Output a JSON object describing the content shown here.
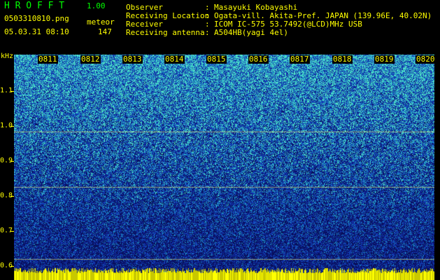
{
  "app": {
    "title": "H R O F F T",
    "version": "1.00"
  },
  "file": {
    "name": "0503310810.png",
    "datetime": "05.03.31 08:10",
    "mode_label": "meteor",
    "count": "147"
  },
  "header": {
    "observer_label": "Observer",
    "observer_value": "Masayuki Kobayashi",
    "location_label": "Receiving Location",
    "location_value": "Ogata-vill. Akita-Pref. JAPAN (139.96E, 40.02N)",
    "receiver_label": "Receiver",
    "receiver_value": "ICOM IC-575 53.7492(@LCD)MHz USB",
    "antenna_label": "Receiving antenna",
    "antenna_value": "A504HB(yagi 4el)",
    "separator": ":"
  },
  "axis": {
    "unit": "kHz",
    "freq_labels": [
      "1.1",
      "1.0",
      "0.9",
      "0.8",
      "0.7",
      "0.6"
    ],
    "time_labels": [
      "0811",
      "0812",
      "0813",
      "0814",
      "0815",
      "0816",
      "0817",
      "0818",
      "0819",
      "0820"
    ]
  },
  "colors": {
    "text_primary": "#ffff00",
    "text_secondary": "#00ff00",
    "background": "#000000",
    "spectrogram_low": "#0a1a6e",
    "spectrogram_high": "#3fe0c8"
  }
}
